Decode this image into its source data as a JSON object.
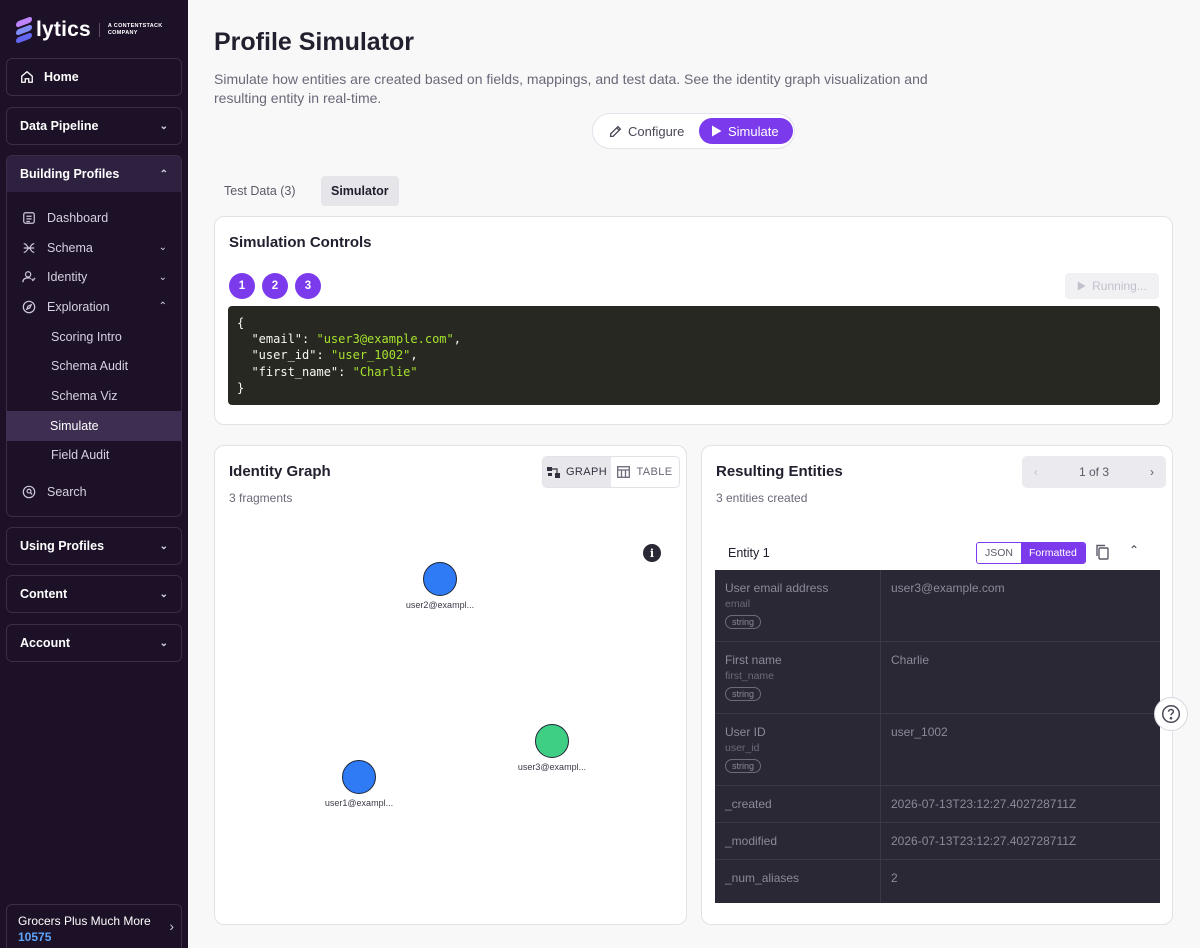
{
  "logo": {
    "name": "lytics",
    "company": "A CONTENTSTACK COMPANY"
  },
  "sidebar": {
    "home": "Home",
    "data_pipeline": "Data Pipeline",
    "building_profiles": {
      "label": "Building Profiles",
      "items": {
        "dashboard": "Dashboard",
        "schema": "Schema",
        "identity": "Identity",
        "exploration": "Exploration",
        "search": "Search"
      },
      "exploration_items": [
        "Scoring Intro",
        "Schema Audit",
        "Schema Viz",
        "Simulate",
        "Field Audit"
      ],
      "active_item": "Simulate"
    },
    "using_profiles": "Using Profiles",
    "content": "Content",
    "account": "Account",
    "footer": {
      "account_name": "Grocers Plus Much More",
      "account_id": "10575"
    }
  },
  "page": {
    "title": "Profile Simulator",
    "description": "Simulate how entities are created based on fields, mappings, and test data. See the identity graph visualization and resulting entity in real-time."
  },
  "mode": {
    "configure": "Configure",
    "simulate": "Simulate",
    "active": "Simulate"
  },
  "tabs": {
    "test_data": "Test Data (3)",
    "simulator": "Simulator",
    "active": "Simulator"
  },
  "controls": {
    "title": "Simulation Controls",
    "steps": [
      "1",
      "2",
      "3"
    ],
    "running": "Running...",
    "code": {
      "open": "{",
      "lines": [
        {
          "key": "\"email\"",
          "value": "\"user3@example.com\"",
          "comma": ","
        },
        {
          "key": "\"user_id\"",
          "value": "\"user_1002\"",
          "comma": ","
        },
        {
          "key": "\"first_name\"",
          "value": "\"Charlie\"",
          "comma": ""
        }
      ],
      "close": "}"
    }
  },
  "graph": {
    "title": "Identity Graph",
    "subtitle": "3 fragments",
    "view_graph": "GRAPH",
    "view_table": "TABLE",
    "active_view": "GRAPH",
    "nodes": [
      {
        "label": "user2@exampl...",
        "color": "#2f7bf6"
      },
      {
        "label": "user3@exampl...",
        "color": "#3ecf84"
      },
      {
        "label": "user1@exampl...",
        "color": "#2f7bf6"
      }
    ]
  },
  "entities": {
    "title": "Resulting Entities",
    "subtitle": "3 entities created",
    "pager": "1 of 3",
    "entity_name": "Entity 1",
    "format_json": "JSON",
    "format_formatted": "Formatted",
    "active_format": "Formatted",
    "rows": [
      {
        "label": "User email address",
        "field": "email",
        "type": "string",
        "value": "user3@example.com"
      },
      {
        "label": "First name",
        "field": "first_name",
        "type": "string",
        "value": "Charlie"
      },
      {
        "label": "User ID",
        "field": "user_id",
        "type": "string",
        "value": "user_1002"
      },
      {
        "label": "_created",
        "value": "2026-07-13T23:12:27.402728711Z"
      },
      {
        "label": "_modified",
        "value": "2026-07-13T23:12:27.402728711Z"
      },
      {
        "label": "_num_aliases",
        "value": "2"
      }
    ]
  },
  "colors": {
    "accent": "#7c3aed",
    "sidebar": "#1c1127"
  }
}
